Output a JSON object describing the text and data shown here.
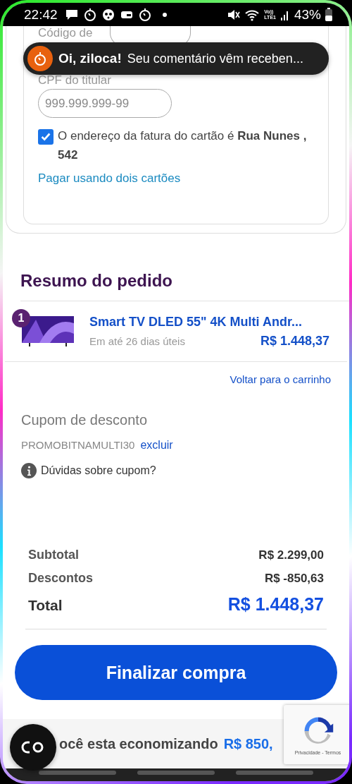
{
  "status_bar": {
    "time": "22:42",
    "network_top": "Vo))",
    "network_bottom": "LTE1",
    "battery": "43%"
  },
  "toast": {
    "greeting": "Oi, ziloca!",
    "message": "Seu comentário vêm receben..."
  },
  "payment_card": {
    "code_label": "Código de",
    "cpf_label": "CPF do titular",
    "cpf_placeholder": "999.999.999-99",
    "billing_address": {
      "checked": true,
      "text": "O endereço da fatura do cartão é **Rua Nunes , 542**"
    },
    "two_cards_link": "Pagar usando dois cartões"
  },
  "order_summary": {
    "title": "Resumo do pedido",
    "items": [
      {
        "quantity": "1",
        "name": "Smart TV DLED 55\" 4K Multi Andr...",
        "delivery": "Em até 26 dias úteis",
        "price": "R$ 1.448,37"
      }
    ],
    "back_link": "Voltar para o carrinho"
  },
  "coupon": {
    "title": "Cupom de desconto",
    "code": "PROMOBITNAMULTI30",
    "remove_link": "excluir",
    "help": "Dúvidas sobre cupom?"
  },
  "totals": [
    {
      "label": "Subtotal",
      "value": "R$ 2.299,00",
      "kind": "line"
    },
    {
      "label": "Descontos",
      "value": "R$ -850,63",
      "kind": "line"
    },
    {
      "label": "Total",
      "value": "R$ 1.448,37",
      "kind": "total"
    }
  ],
  "checkout_button": "Finalizar compra",
  "savings": {
    "text": "ocê esta economizando",
    "amount": "R$ 850,"
  },
  "recaptcha": {
    "links": "Privacidade - Termos"
  }
}
